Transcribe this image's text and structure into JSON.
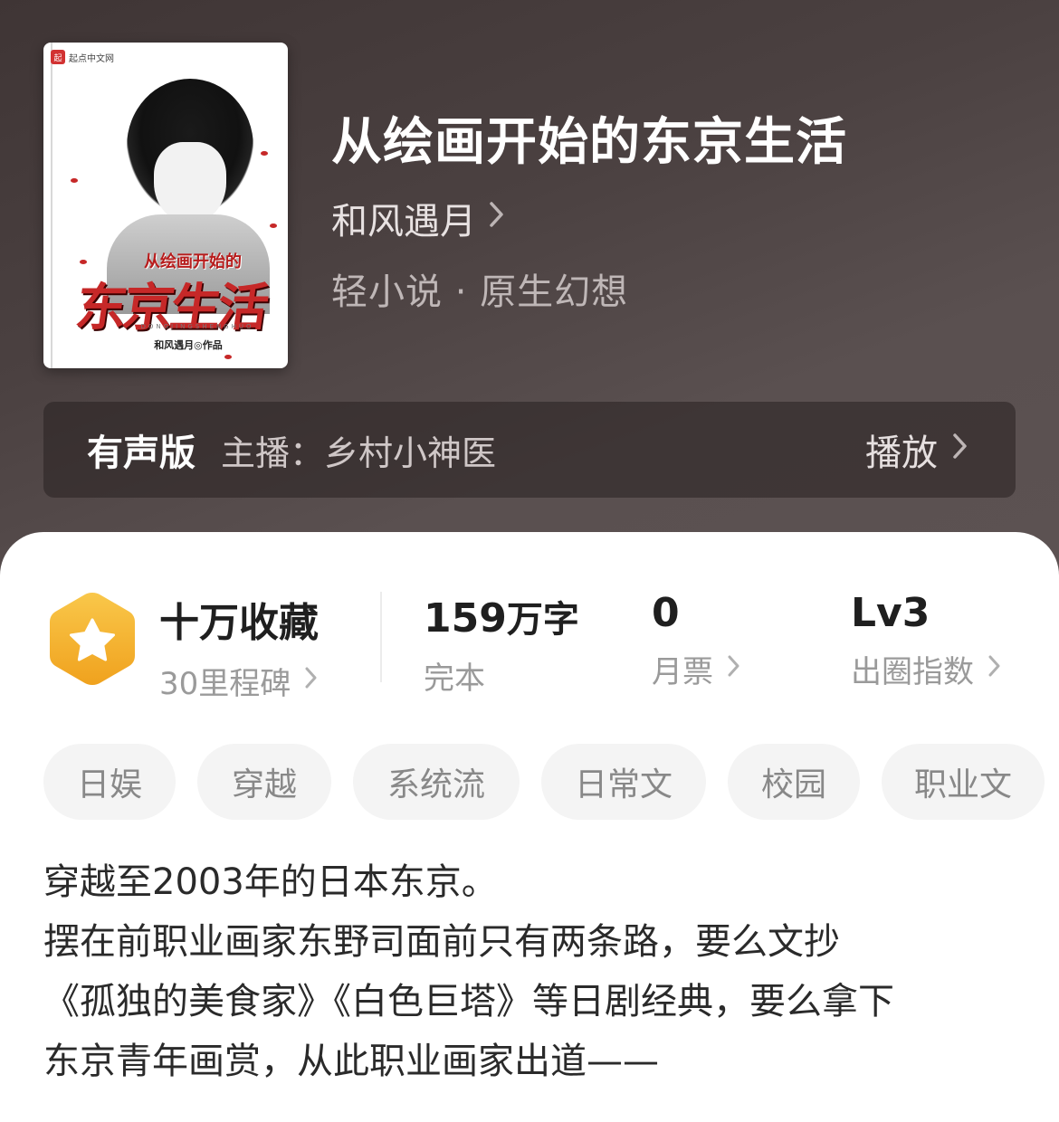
{
  "book": {
    "title": "从绘画开始的东京生活",
    "author": "和风遇月",
    "genre": "轻小说 · 原生幻想",
    "cover": {
      "publisher_logo": "起点中文网",
      "subtitle": "从绘画开始的",
      "main_title": "东京生活",
      "pinyin": "DONGJINGSHENGHUO",
      "author_mark": "和风遇月◎作品"
    }
  },
  "audio": {
    "label": "有声版",
    "host": "主播：乡村小神医",
    "play_label": "播放"
  },
  "stats": {
    "collections": {
      "value": "十万收藏",
      "sub": "30里程碑"
    },
    "words": {
      "value": "159",
      "unit": "万字",
      "sub": "完本"
    },
    "monthly_tickets": {
      "value": "0",
      "sub": "月票"
    },
    "circle_index": {
      "value": "Lv3",
      "sub": "出圈指数"
    }
  },
  "tags": [
    "日娱",
    "穿越",
    "系统流",
    "日常文",
    "校园",
    "职业文"
  ],
  "description": [
    "穿越至2003年的日本东京。",
    "摆在前职业画家东野司面前只有两条路，要么文抄",
    "《孤独的美食家》《白色巨塔》等日剧经典，要么拿下",
    "东京青年画赏，从此职业画家出道——"
  ],
  "icons": {
    "chevron": "chevron-right-icon",
    "badge": "star-hexagon-icon"
  },
  "colors": {
    "hero_bg": "#4b4141",
    "badge_gold": "#f5b335",
    "accent_red": "#c62828"
  }
}
